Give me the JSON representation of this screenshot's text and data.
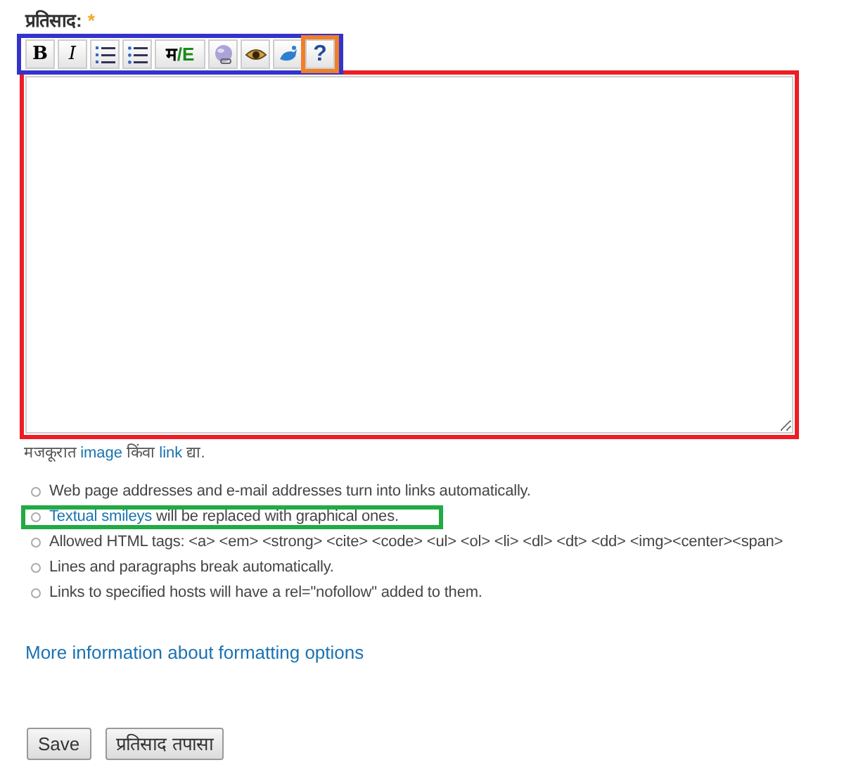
{
  "field": {
    "label": "प्रतिसाद:",
    "required_mark": "*"
  },
  "toolbar": {
    "buttons": [
      {
        "kind": "bold",
        "label": "B"
      },
      {
        "kind": "italic",
        "label": "I"
      },
      {
        "kind": "ordered-list"
      },
      {
        "kind": "bullet-list"
      },
      {
        "kind": "language",
        "label": "म",
        "label_2": "/E"
      },
      {
        "kind": "link"
      },
      {
        "kind": "preview"
      },
      {
        "kind": "image"
      },
      {
        "kind": "help",
        "label": "?",
        "highlighted": true
      }
    ]
  },
  "hint_parts": [
    "मजकूरात ",
    "image",
    " किंवा ",
    "link",
    " द्या."
  ],
  "tips": [
    {
      "text": "Web page addresses and e-mail addresses turn into links automatically."
    },
    {
      "link": "Textual smileys",
      "text": " will be replaced with graphical ones.",
      "highlighted": true
    },
    {
      "text": "Allowed HTML tags: <a> <em> <strong> <cite> <code> <ul> <ol> <li> <dl> <dt> <dd> <img><center><span>"
    },
    {
      "text": "Lines and paragraphs break automatically."
    },
    {
      "text": "Links to specified hosts will have a rel=\"nofollow\" added to them."
    }
  ],
  "more_link": "More information about formatting options",
  "buttons": [
    "Save",
    "प्रतिसाद तपासा"
  ]
}
